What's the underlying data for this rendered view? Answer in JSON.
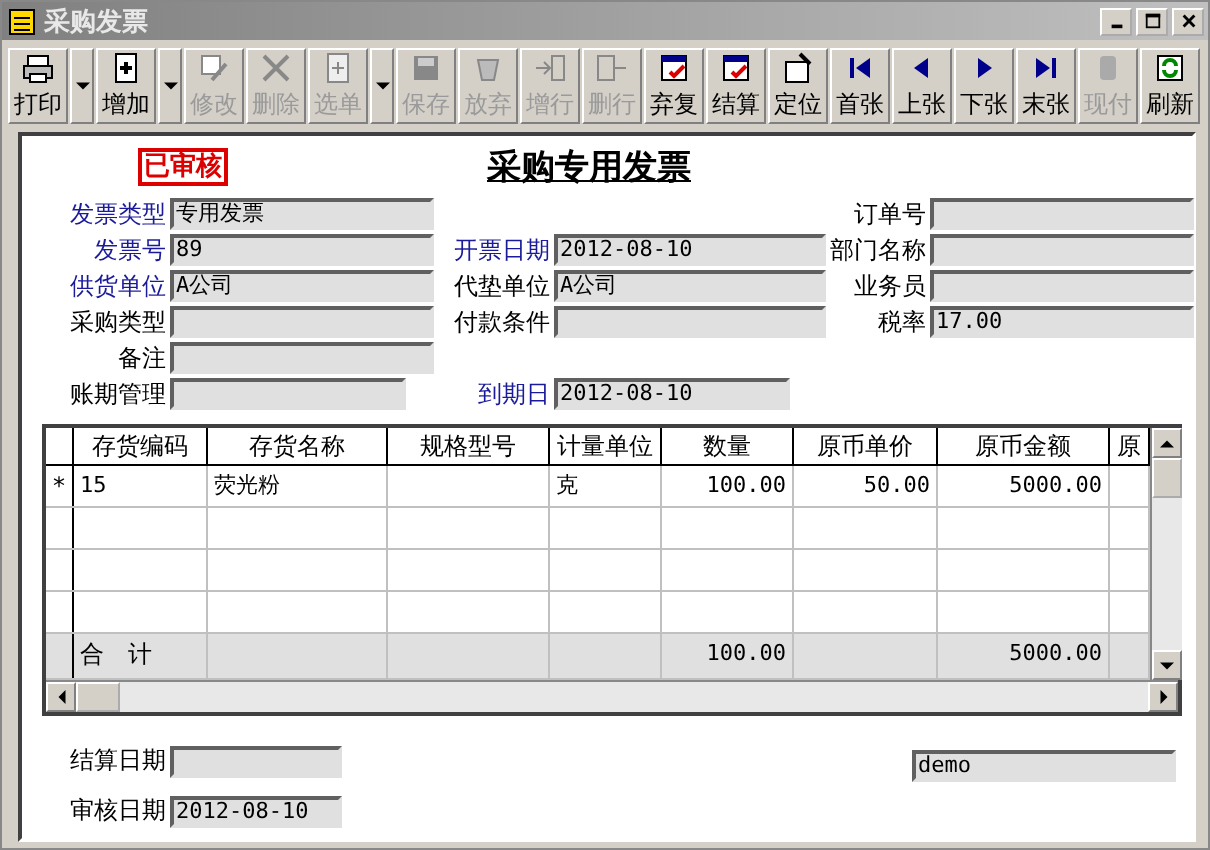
{
  "window": {
    "title": "采购发票"
  },
  "toolbar": [
    {
      "kind": "button",
      "label": "打印",
      "disabled": false
    },
    {
      "kind": "dropdown",
      "disabled": false
    },
    {
      "kind": "button",
      "label": "增加",
      "disabled": false
    },
    {
      "kind": "dropdown",
      "disabled": false
    },
    {
      "kind": "button",
      "label": "修改",
      "disabled": true
    },
    {
      "kind": "button",
      "label": "删除",
      "disabled": true
    },
    {
      "kind": "button",
      "label": "选单",
      "disabled": true
    },
    {
      "kind": "dropdown",
      "disabled": false
    },
    {
      "kind": "button",
      "label": "保存",
      "disabled": true
    },
    {
      "kind": "button",
      "label": "放弃",
      "disabled": true
    },
    {
      "kind": "button",
      "label": "增行",
      "disabled": true
    },
    {
      "kind": "button",
      "label": "删行",
      "disabled": true
    },
    {
      "kind": "button",
      "label": "弃复",
      "disabled": false
    },
    {
      "kind": "button",
      "label": "结算",
      "disabled": false
    },
    {
      "kind": "button",
      "label": "定位",
      "disabled": false
    },
    {
      "kind": "button",
      "label": "首张",
      "disabled": false
    },
    {
      "kind": "button",
      "label": "上张",
      "disabled": false
    },
    {
      "kind": "button",
      "label": "下张",
      "disabled": false
    },
    {
      "kind": "button",
      "label": "末张",
      "disabled": false
    },
    {
      "kind": "button",
      "label": "现付",
      "disabled": true
    },
    {
      "kind": "button",
      "label": "刷新",
      "disabled": false
    }
  ],
  "form": {
    "stamp": "已审核",
    "title": "采购专用发票",
    "header_rows": [
      {
        "left": {
          "label": "发票类型",
          "value": "专用发票",
          "required": true
        },
        "right": {
          "label": "订单号",
          "required": false
        }
      },
      {
        "left": {
          "label": "发票号",
          "value": "89",
          "required": true
        },
        "middle": {
          "label": "开票日期",
          "value": "2012-08-10",
          "required": true
        },
        "right": {
          "label": "部门名称",
          "required": false
        }
      },
      {
        "left": {
          "label": "供货单位",
          "value": "A公司",
          "required": true
        },
        "middle": {
          "label": "代垫单位",
          "value": "A公司",
          "required": false
        },
        "right": {
          "label": "业务员",
          "required": false
        }
      },
      {
        "left": {
          "label": "采购类型",
          "required": false
        },
        "middle": {
          "label": "付款条件",
          "required": false
        },
        "right": {
          "label": "税率",
          "value": "17.00",
          "required": false
        }
      },
      {
        "left": {
          "label": "备注",
          "required": false
        }
      },
      {
        "left": {
          "label": "账期管理",
          "required": false
        },
        "middle": {
          "label": "到期日",
          "value": "2012-08-10",
          "required": true
        }
      }
    ],
    "table": {
      "columns": [
        "存货编码",
        "存货名称",
        "规格型号",
        "计量单位",
        "数量",
        "原币单价",
        "原币金额",
        "原"
      ],
      "rows": [
        {
          "marker": "*",
          "cells": [
            "15",
            "荧光粉",
            null,
            "克",
            "100.00",
            "50.00",
            "5000.00",
            null
          ]
        },
        {
          "cells": [
            null,
            null,
            null,
            null,
            null,
            null,
            null,
            null
          ]
        },
        {
          "cells": [
            null,
            null,
            null,
            null,
            null,
            null,
            null,
            null
          ]
        },
        {
          "cells": [
            null,
            null,
            null,
            null,
            null,
            null,
            null,
            null
          ]
        }
      ],
      "total": {
        "label": "合　计",
        "cells": [
          null,
          null,
          null,
          "100.00",
          null,
          "5000.00",
          null
        ]
      }
    },
    "footer_fields": [
      {
        "label": "结算日期"
      },
      {
        "label": "审核日期",
        "value": "2012-08-10"
      }
    ],
    "footer_right_field": {
      "value": "demo"
    }
  }
}
